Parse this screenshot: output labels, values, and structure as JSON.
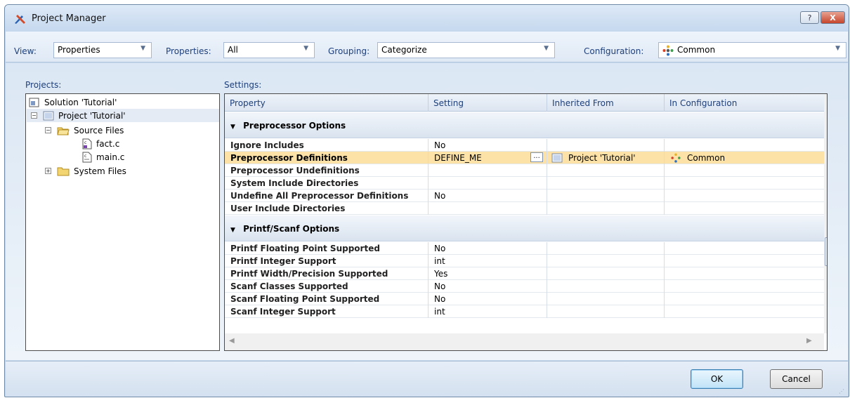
{
  "window": {
    "title": "Project Manager",
    "help_label": "?",
    "close_label": "X"
  },
  "toolbar": {
    "view_label": "View:",
    "view_value": "Properties",
    "properties_label": "Properties:",
    "properties_value": "All",
    "grouping_label": "Grouping:",
    "grouping_value": "Categorize",
    "configuration_label": "Configuration:",
    "configuration_value": "Common"
  },
  "projects": {
    "label": "Projects:",
    "items": [
      {
        "label": "Solution 'Tutorial'"
      },
      {
        "label": "Project 'Tutorial'"
      },
      {
        "label": "Source Files"
      },
      {
        "label": "fact.c"
      },
      {
        "label": "main.c"
      },
      {
        "label": "System Files"
      }
    ]
  },
  "settings": {
    "label": "Settings:",
    "columns": [
      "Property",
      "Setting",
      "Inherited From",
      "In Configuration"
    ],
    "categories": [
      {
        "name": "Preprocessor Options",
        "rows": [
          {
            "property": "Ignore Includes",
            "setting": "No",
            "inherited": "",
            "config": ""
          },
          {
            "property": "Preprocessor Definitions",
            "setting": "DEFINE_ME",
            "inherited": "Project 'Tutorial'",
            "config": "Common"
          },
          {
            "property": "Preprocessor Undefinitions",
            "setting": "",
            "inherited": "",
            "config": ""
          },
          {
            "property": "System Include Directories",
            "setting": "",
            "inherited": "",
            "config": ""
          },
          {
            "property": "Undefine All Preprocessor Definitions",
            "setting": "No",
            "inherited": "",
            "config": ""
          },
          {
            "property": "User Include Directories",
            "setting": "",
            "inherited": "",
            "config": ""
          }
        ]
      },
      {
        "name": "Printf/Scanf Options",
        "rows": [
          {
            "property": "Printf Floating Point Supported",
            "setting": "No",
            "inherited": "",
            "config": ""
          },
          {
            "property": "Printf Integer Support",
            "setting": "int",
            "inherited": "",
            "config": ""
          },
          {
            "property": "Printf Width/Precision Supported",
            "setting": "Yes",
            "inherited": "",
            "config": ""
          },
          {
            "property": "Scanf Classes Supported",
            "setting": "No",
            "inherited": "",
            "config": ""
          },
          {
            "property": "Scanf Floating Point Supported",
            "setting": "No",
            "inherited": "",
            "config": ""
          },
          {
            "property": "Scanf Integer Support",
            "setting": "int",
            "inherited": "",
            "config": ""
          }
        ]
      }
    ],
    "ellipsis": "..."
  },
  "buttons": {
    "ok": "OK",
    "cancel": "Cancel"
  },
  "colors": {
    "highlight_row": "#fce2a6",
    "label_blue": "#1e3f7a",
    "close_red": "#c6452c"
  }
}
